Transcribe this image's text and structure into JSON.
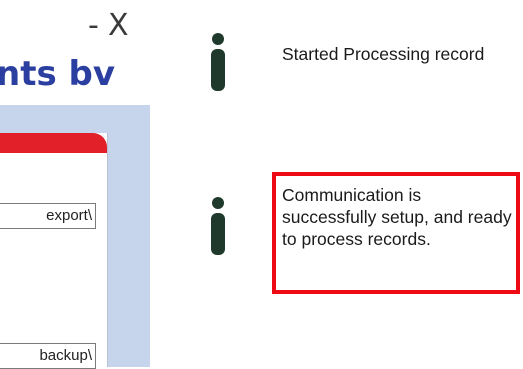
{
  "window": {
    "minimize_label": "-",
    "close_label": "X"
  },
  "app": {
    "title_fragment": "nts bv"
  },
  "panel": {
    "export_path": "export\\",
    "backup_path": "backup\\"
  },
  "log": [
    {
      "icon": "info-icon",
      "message": "Started Processing record",
      "highlighted": false
    },
    {
      "icon": "info-icon",
      "message": "Communication is successfully setup, and ready to process records.",
      "highlighted": true
    }
  ],
  "colors": {
    "title_blue": "#2a3fa0",
    "panel_blue": "#c6d5ec",
    "header_red": "#e2202a",
    "highlight_red": "#ee0a12",
    "icon_green": "#1f3a2c"
  }
}
